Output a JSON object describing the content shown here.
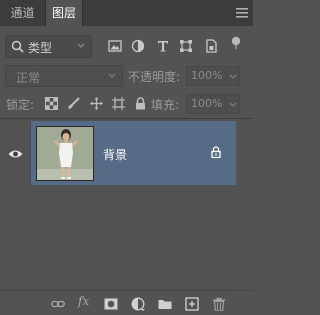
{
  "tabs": [
    {
      "label": "通道",
      "active": false
    },
    {
      "label": "图层",
      "active": true
    }
  ],
  "filter": {
    "kind_label": "类型",
    "icons": [
      "image-filter-icon",
      "adjustment-filter-icon",
      "type-filter-icon",
      "shape-filter-icon",
      "smart-object-filter-icon",
      "filter-toggle-dot"
    ]
  },
  "blend": {
    "mode": "正常",
    "opacity_label": "不透明度:",
    "opacity_value": "100%"
  },
  "locks": {
    "label": "锁定:",
    "icons": [
      "lock-transparent-icon",
      "lock-paint-icon",
      "lock-move-icon",
      "lock-artboard-icon",
      "lock-all-icon"
    ],
    "fill_label": "填充:",
    "fill_value": "100%"
  },
  "layers": [
    {
      "name": "背景",
      "visible": true,
      "locked": true,
      "selected": true
    }
  ],
  "footer_icons": [
    "link-layers-icon",
    "fx-icon",
    "add-mask-icon",
    "adjustment-layer-icon",
    "group-folder-icon",
    "new-layer-icon",
    "trash-icon"
  ],
  "colors": {
    "panel_bg": "#535353",
    "tab_bar_bg": "#3c3c3c",
    "selected_row": "#556b86"
  }
}
